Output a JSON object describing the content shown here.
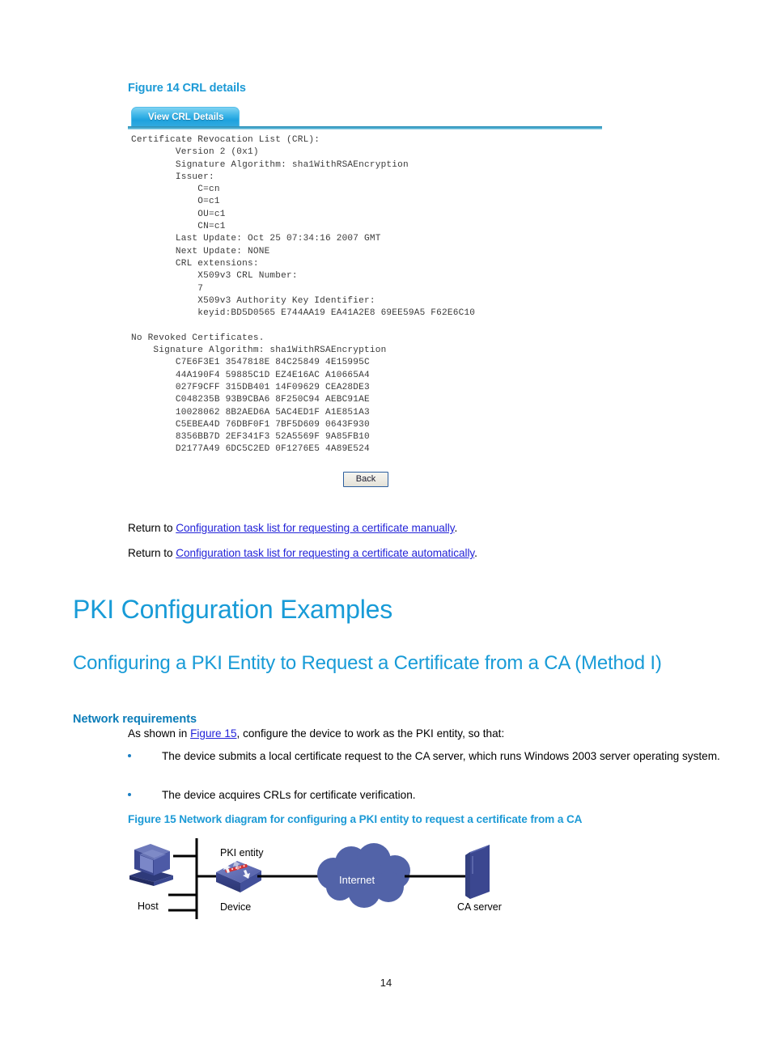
{
  "figure14": {
    "caption": "Figure 14 CRL details",
    "tab_label": "View CRL Details",
    "crl_text": "Certificate Revocation List (CRL):\n        Version 2 (0x1)\n        Signature Algorithm: sha1WithRSAEncryption\n        Issuer:\n            C=cn\n            O=c1\n            OU=c1\n            CN=c1\n        Last Update: Oct 25 07:34:16 2007 GMT\n        Next Update: NONE\n        CRL extensions:\n            X509v3 CRL Number:\n            7\n            X509v3 Authority Key Identifier:\n            keyid:BD5D0565 E744AA19 EA41A2E8 69EE59A5 F62E6C10\n\nNo Revoked Certificates.\n    Signature Algorithm: sha1WithRSAEncryption\n        C7E6F3E1 3547818E 84C25849 4E15995C\n        44A190F4 59885C1D EZ4E16AC A10665A4\n        027F9CFF 315DB401 14F09629 CEA28DE3\n        C048235B 93B9CBA6 8F250C94 AEBC91AE\n        10028062 8B2AED6A 5AC4ED1F A1E851A3\n        C5EBEA4D 76DBF0F1 7BF5D609 0643F930\n        8356BB7D 2EF341F3 52A5569F 9A85FB10\n        D2177A49 6DC5C2ED 0F1276E5 4A89E524",
    "back_button": "Back"
  },
  "return_links": [
    {
      "prefix": "Return to ",
      "link": "Configuration task list for requesting a certificate manually",
      "suffix": "."
    },
    {
      "prefix": "Return to ",
      "link": "Configuration task list for requesting a certificate automatically",
      "suffix": "."
    }
  ],
  "headings": {
    "h1": "PKI Configuration Examples",
    "h2": "Configuring a PKI Entity to Request a Certificate from a CA (Method I)",
    "h3": "Network requirements"
  },
  "intro": {
    "prefix": "As shown in ",
    "link": "Figure 15",
    "suffix": ", configure the device to work as the PKI entity, so that:"
  },
  "bullets": [
    "The device submits a local certificate request to the CA server, which runs Windows 2003 server operating system.",
    "The device acquires CRLs for certificate verification."
  ],
  "figure15": {
    "caption": "Figure 15 Network diagram for configuring a PKI entity to request a certificate from a CA",
    "labels": {
      "host": "Host",
      "pki_entity": "PKI entity",
      "device": "Device",
      "internet": "Internet",
      "ca_server": "CA server"
    }
  },
  "page_number": "14",
  "colors": {
    "heading_blue": "#189BD7",
    "caption_blue": "#1C9AD6",
    "subheading_blue": "#0A7CB8",
    "link_blue": "#2323D8",
    "tab_blue": "#1EA2DE",
    "diagram_blue": "#4F5FA8",
    "bullet_blue": "#1B7FC4"
  }
}
